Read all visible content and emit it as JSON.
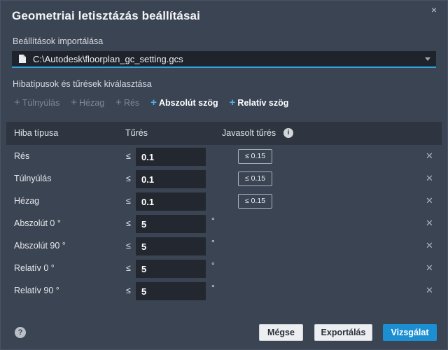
{
  "dialog": {
    "title": "Geometriai letisztázás beállításai",
    "close_icon": "×"
  },
  "import": {
    "label": "Beállítások importálása",
    "file_path": "C:\\Autodesk\\floorplan_gc_setting.gcs"
  },
  "types": {
    "label": "Hibatípusok és tűrések kiválasztása",
    "buttons": [
      {
        "label": "Túlnyúlás",
        "enabled": false
      },
      {
        "label": "Hézag",
        "enabled": false
      },
      {
        "label": "Rés",
        "enabled": false
      },
      {
        "label": "Abszolút szög",
        "enabled": true
      },
      {
        "label": "Relatív szög",
        "enabled": true
      }
    ]
  },
  "table": {
    "headers": {
      "type": "Hiba típusa",
      "tolerance": "Tűrés",
      "suggested": "Javasolt tűrés"
    },
    "rows": [
      {
        "name": "Rés",
        "op": "≤",
        "value": "0.1",
        "unit": "",
        "suggestion": "≤ 0.15"
      },
      {
        "name": "Túlnyúlás",
        "op": "≤",
        "value": "0.1",
        "unit": "",
        "suggestion": "≤ 0.15"
      },
      {
        "name": "Hézag",
        "op": "≤",
        "value": "0.1",
        "unit": "",
        "suggestion": "≤ 0.15"
      },
      {
        "name": "Abszolút 0 °",
        "op": "≤",
        "value": "5",
        "unit": "°",
        "suggestion": ""
      },
      {
        "name": "Abszolút 90 °",
        "op": "≤",
        "value": "5",
        "unit": "°",
        "suggestion": ""
      },
      {
        "name": "Relatív 0 °",
        "op": "≤",
        "value": "5",
        "unit": "°",
        "suggestion": ""
      },
      {
        "name": "Relatív 90 °",
        "op": "≤",
        "value": "5",
        "unit": "°",
        "suggestion": ""
      }
    ]
  },
  "footer": {
    "cancel": "Mégse",
    "export": "Exportálás",
    "check": "Vizsgálat"
  },
  "colors": {
    "accent": "#1b8fd2",
    "background": "#3b4453"
  }
}
